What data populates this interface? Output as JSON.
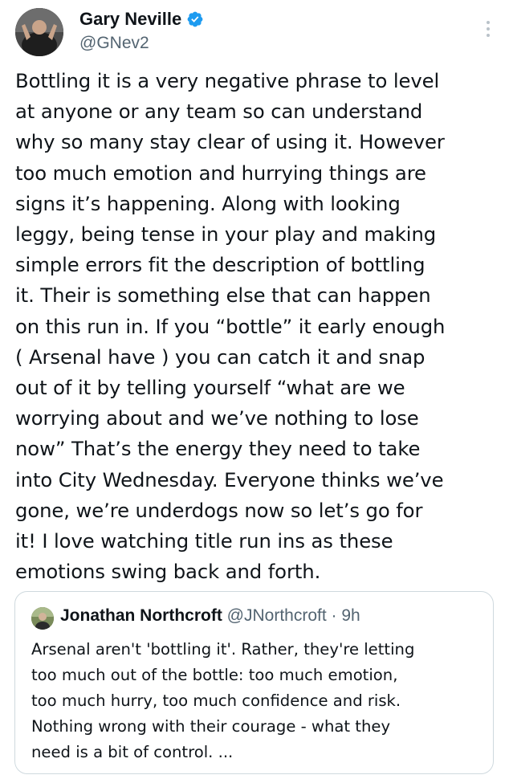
{
  "author": {
    "name": "Gary Neville",
    "handle": "@GNev2",
    "verified": true
  },
  "tweet": {
    "text": "Bottling it is a very negative phrase to level\nat anyone or any team so can understand\nwhy so many stay clear of using it. However\ntoo much emotion and hurrying things are\nsigns it’s happening. Along with looking\nleggy, being tense in your play and making\nsimple errors fit the description of bottling\nit. Their is something else that can happen\non this run in. If you “bottle” it early enough\n( Arsenal have ) you can catch it and snap\nout of it by telling yourself “what are we\nworrying about and we’ve nothing to lose\nnow” That’s the energy they need to take\ninto City Wednesday. Everyone thinks we’ve\ngone, we’re underdogs now so let’s go for\nit! I love watching title run ins as these\nemotions swing back and forth."
  },
  "quoted": {
    "name": "Jonathan Northcroft",
    "handle": "@JNorthcroft",
    "separator": "·",
    "time": "9h",
    "text": "Arsenal aren't 'bottling it'. Rather, they're letting\ntoo much out of the bottle: too much emotion,\ntoo much hurry, too much confidence and risk.\nNothing wrong with their courage - what they\nneed is a bit of control. ..."
  },
  "icons": {
    "verified": "verified-badge-icon",
    "more": "more-options-icon"
  },
  "colors": {
    "verified": "#1d9bf0",
    "text": "#0f1419",
    "secondary": "#536471",
    "border": "#cfd9de"
  }
}
